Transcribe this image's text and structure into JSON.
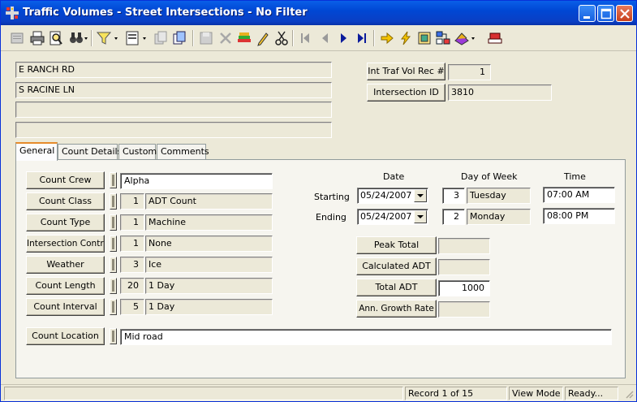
{
  "window": {
    "title": "Traffic Volumes - Street Intersections - No Filter"
  },
  "icons": {
    "app": "intersection-icon",
    "minimize": "minimize-icon",
    "maximize": "maximize-icon",
    "close": "close-icon"
  },
  "header": {
    "streets": [
      "E RANCH RD",
      "S RACINE LN",
      "",
      ""
    ],
    "int_traf_vol_rec_label": "Int Traf Vol Rec #",
    "int_traf_vol_rec_value": "1",
    "intersection_id_label": "Intersection ID",
    "intersection_id_value": "3810"
  },
  "tabs": [
    {
      "label": "General",
      "active": true
    },
    {
      "label": "Count Details",
      "active": false
    },
    {
      "label": "Custom",
      "active": false
    },
    {
      "label": "Comments",
      "active": false
    }
  ],
  "general": {
    "count_crew": {
      "label": "Count Crew",
      "value": "Alpha"
    },
    "count_class": {
      "label": "Count Class",
      "code": "1",
      "value": "ADT Count"
    },
    "count_type": {
      "label": "Count Type",
      "code": "1",
      "value": "Machine"
    },
    "intersection_control": {
      "label": "Intersection Control",
      "code": "1",
      "value": "None"
    },
    "weather": {
      "label": "Weather",
      "code": "3",
      "value": "Ice"
    },
    "count_length": {
      "label": "Count Length",
      "code": "20",
      "value": "1 Day"
    },
    "count_interval": {
      "label": "Count Interval",
      "code": "5",
      "value": "1 Day"
    },
    "count_location": {
      "label": "Count Location",
      "value": "Mid road"
    }
  },
  "schedule": {
    "date_header": "Date",
    "dow_header": "Day of Week",
    "time_header": "Time",
    "starting_label": "Starting",
    "ending_label": "Ending",
    "start_date": "05/24/2007",
    "start_dow_code": "3",
    "start_dow": "Tuesday",
    "start_time": "07:00 AM",
    "end_date": "05/24/2007",
    "end_dow_code": "2",
    "end_dow": "Monday",
    "end_time": "08:00 PM"
  },
  "totals": {
    "peak_total_label": "Peak Total",
    "peak_total_value": "",
    "calculated_adt_label": "Calculated ADT",
    "calculated_adt_value": "",
    "total_adt_label": "Total ADT",
    "total_adt_value": "1000",
    "ann_growth_rate_label": "Ann. Growth Rate",
    "ann_growth_rate_value": ""
  },
  "status": {
    "record": "Record 1 of 15",
    "mode": "View Mode",
    "state": "Ready..."
  }
}
